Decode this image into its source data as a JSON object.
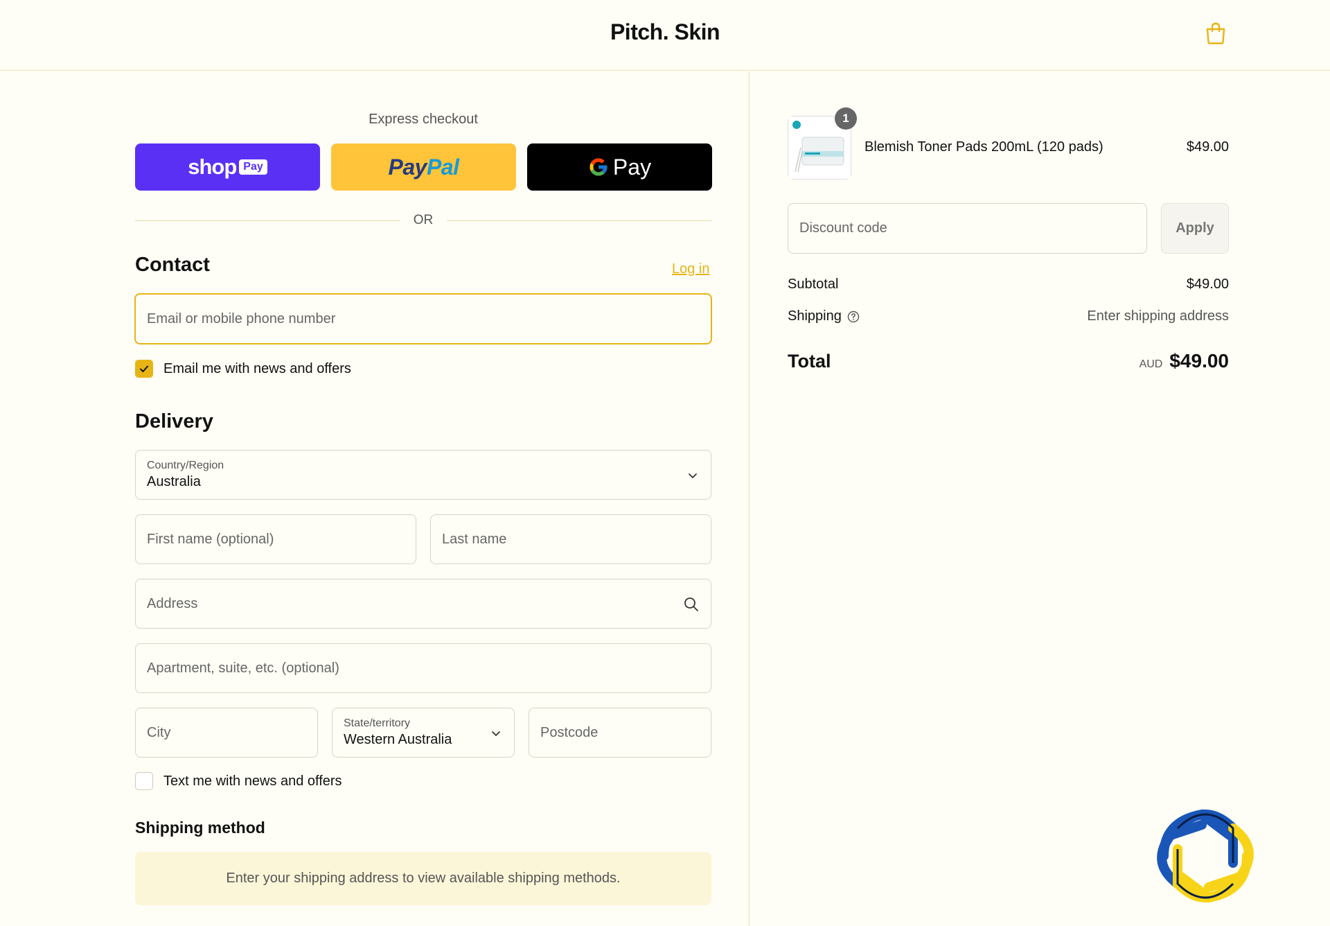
{
  "header": {
    "brand": "Pitch. Skin",
    "cart_icon": "shopping-bag-icon"
  },
  "express": {
    "label": "Express checkout",
    "shop_pay": {
      "text": "shop",
      "badge": "Pay",
      "color": "#5a31f4"
    },
    "paypal": {
      "part1": "Pay",
      "part2": "Pal",
      "color": "#ffc439"
    },
    "gpay": {
      "text": "Pay",
      "color": "#000000"
    },
    "divider": "OR"
  },
  "contact": {
    "title": "Contact",
    "login": "Log in",
    "email_placeholder": "Email or mobile phone number",
    "email_optin": "Email me with news and offers",
    "email_optin_checked": true
  },
  "delivery": {
    "title": "Delivery",
    "country_label": "Country/Region",
    "country_value": "Australia",
    "first_name_placeholder": "First name (optional)",
    "last_name_placeholder": "Last name",
    "address_placeholder": "Address",
    "apartment_placeholder": "Apartment, suite, etc. (optional)",
    "city_placeholder": "City",
    "state_label": "State/territory",
    "state_value": "Western Australia",
    "postcode_placeholder": "Postcode",
    "sms_optin": "Text me with news and offers",
    "sms_optin_checked": false
  },
  "shipping_method": {
    "title": "Shipping method",
    "message": "Enter your shipping address to view available shipping methods."
  },
  "summary": {
    "item": {
      "name": "Blemish Toner Pads 200mL (120 pads)",
      "price": "$49.00",
      "quantity": "1"
    },
    "discount_placeholder": "Discount code",
    "apply": "Apply",
    "subtotal_label": "Subtotal",
    "subtotal_value": "$49.00",
    "shipping_label": "Shipping",
    "shipping_value": "Enter shipping address",
    "total_label": "Total",
    "currency": "AUD",
    "total_value": "$49.00"
  },
  "colors": {
    "accent": "#e7b416",
    "background": "#fefdf6",
    "watermark_blue": "#1a56b8",
    "watermark_yellow": "#f7d417"
  }
}
